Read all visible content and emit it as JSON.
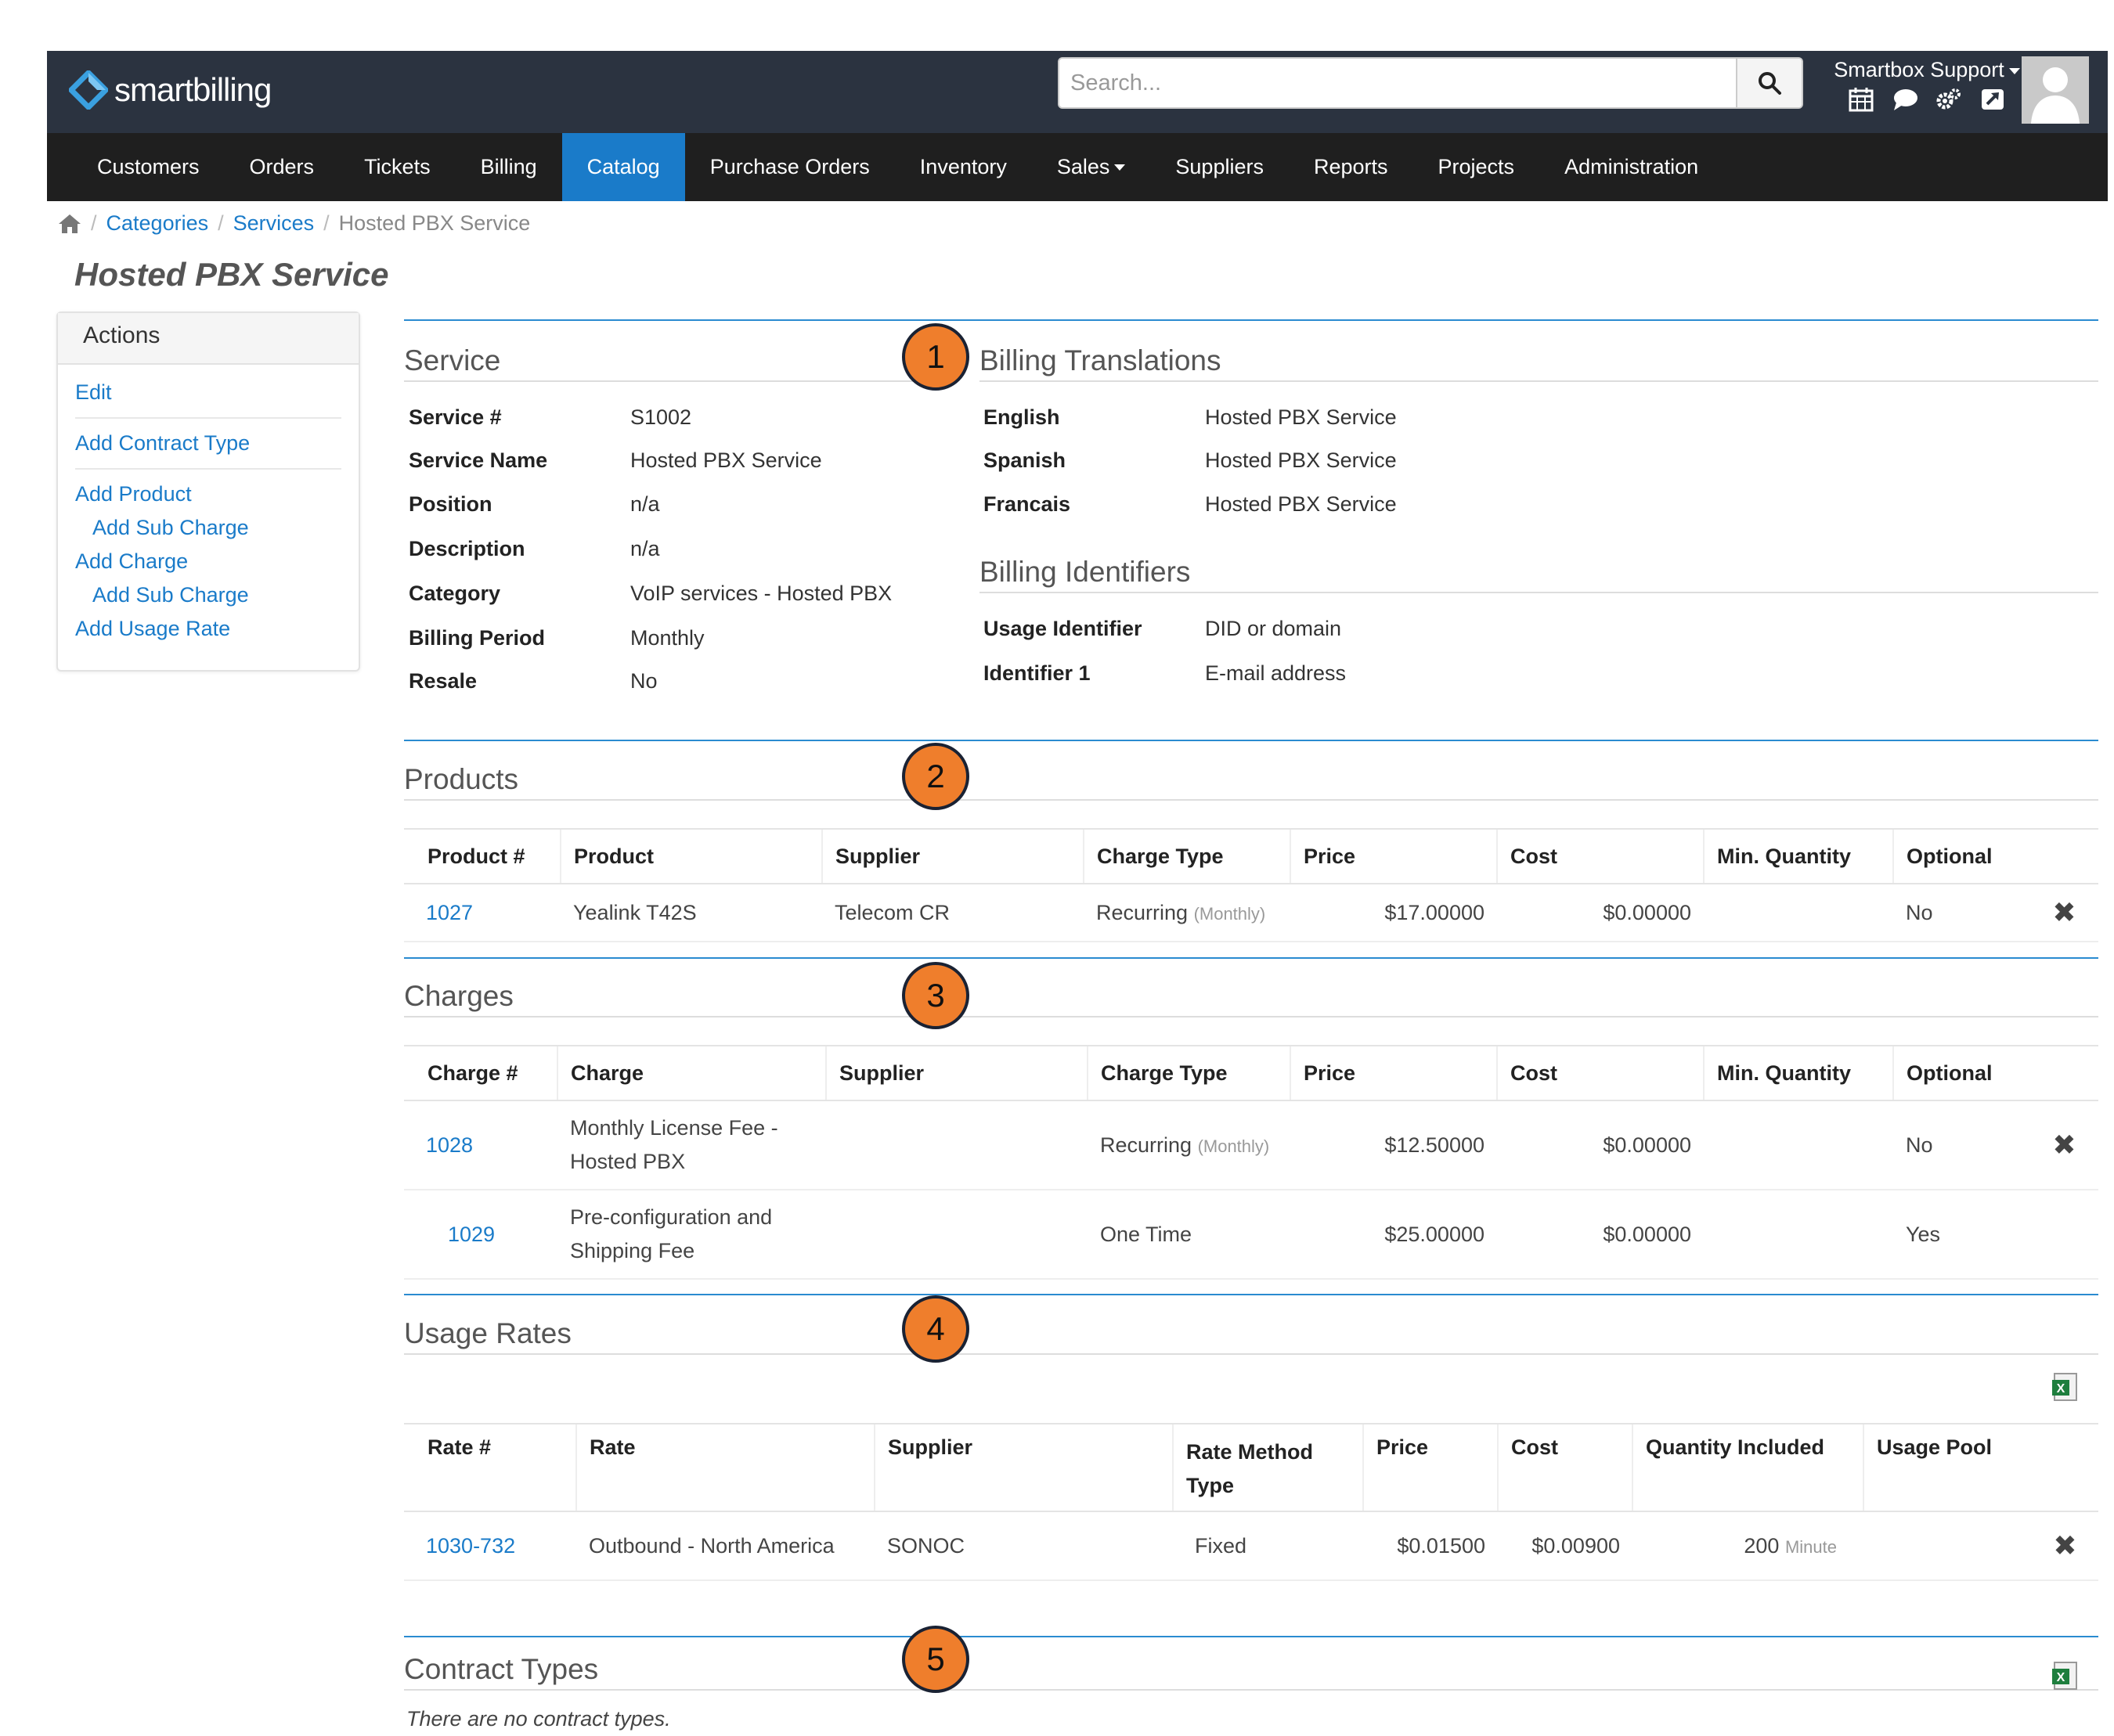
{
  "app": {
    "logo_text": "smartbilling"
  },
  "search": {
    "placeholder": "Search..."
  },
  "user": {
    "name": "Smartbox Support"
  },
  "nav": [
    "Customers",
    "Orders",
    "Tickets",
    "Billing",
    "Catalog",
    "Purchase Orders",
    "Inventory",
    "Sales",
    "Suppliers",
    "Reports",
    "Projects",
    "Administration"
  ],
  "breadcrumb": {
    "categories": "Categories",
    "services": "Services",
    "current": "Hosted PBX Service"
  },
  "page_title": "Hosted PBX Service",
  "actions": {
    "title": "Actions",
    "items": [
      "Edit",
      "Add Contract Type",
      "Add Product",
      "Add Sub Charge",
      "Add Charge",
      "Add Sub Charge",
      "Add Usage Rate"
    ]
  },
  "badges": [
    "1",
    "2",
    "3",
    "4",
    "5"
  ],
  "service": {
    "title": "Service",
    "fields": [
      {
        "label": "Service #",
        "value": "S1002"
      },
      {
        "label": "Service Name",
        "value": "Hosted PBX Service"
      },
      {
        "label": "Position",
        "value": "n/a"
      },
      {
        "label": "Description",
        "value": "n/a"
      },
      {
        "label": "Category",
        "value": "VoIP services - Hosted PBX"
      },
      {
        "label": "Billing Period",
        "value": "Monthly"
      },
      {
        "label": "Resale",
        "value": "No"
      }
    ]
  },
  "translations": {
    "title": "Billing Translations",
    "fields": [
      {
        "label": "English",
        "value": "Hosted PBX Service"
      },
      {
        "label": "Spanish",
        "value": "Hosted PBX Service"
      },
      {
        "label": "Francais",
        "value": "Hosted PBX Service"
      }
    ]
  },
  "identifiers": {
    "title": "Billing Identifiers",
    "fields": [
      {
        "label": "Usage Identifier",
        "value": "DID or domain"
      },
      {
        "label": "Identifier 1",
        "value": "E-mail address"
      }
    ]
  },
  "products": {
    "title": "Products",
    "headers": [
      "Product #",
      "Product",
      "Supplier",
      "Charge Type",
      "Price",
      "Cost",
      "Min. Quantity",
      "Optional"
    ],
    "rows": [
      {
        "num": "1027",
        "name": "Yealink T42S",
        "supplier": "Telecom CR",
        "type": "Recurring",
        "period": "(Monthly)",
        "price": "$17.00000",
        "cost": "$0.00000",
        "min": "",
        "optional": "No"
      }
    ]
  },
  "charges": {
    "title": "Charges",
    "headers": [
      "Charge #",
      "Charge",
      "Supplier",
      "Charge Type",
      "Price",
      "Cost",
      "Min. Quantity",
      "Optional"
    ],
    "rows": [
      {
        "num": "1028",
        "name_line1": "Monthly License Fee -",
        "name_line2": "Hosted PBX",
        "supplier": "",
        "type": "Recurring",
        "period": "(Monthly)",
        "price": "$12.50000",
        "cost": "$0.00000",
        "min": "",
        "optional": "No"
      },
      {
        "num": "1029",
        "name_line1": "Pre-configuration and",
        "name_line2": "Shipping Fee",
        "supplier": "",
        "type": "One Time",
        "period": "",
        "price": "$25.00000",
        "cost": "$0.00000",
        "min": "",
        "optional": "Yes"
      }
    ]
  },
  "usage_rates": {
    "title": "Usage Rates",
    "headers": [
      "Rate #",
      "Rate",
      "Supplier",
      "Rate Method",
      "Type",
      "Price",
      "Cost",
      "Quantity Included",
      "Usage Pool"
    ],
    "rows": [
      {
        "num": "1030-732",
        "rate": "Outbound - North America",
        "supplier": "SONOC",
        "method": "Fixed",
        "price": "$0.01500",
        "cost": "$0.00900",
        "qty": "200",
        "unit": "Minute",
        "pool": ""
      }
    ]
  },
  "contract_types": {
    "title": "Contract Types",
    "empty_text": "There are no contract types."
  },
  "colors": {
    "topbar": "#2b3340",
    "navbar": "#1f1f1f",
    "accent": "#1a7bc9",
    "badge": "#ef7e2c"
  }
}
